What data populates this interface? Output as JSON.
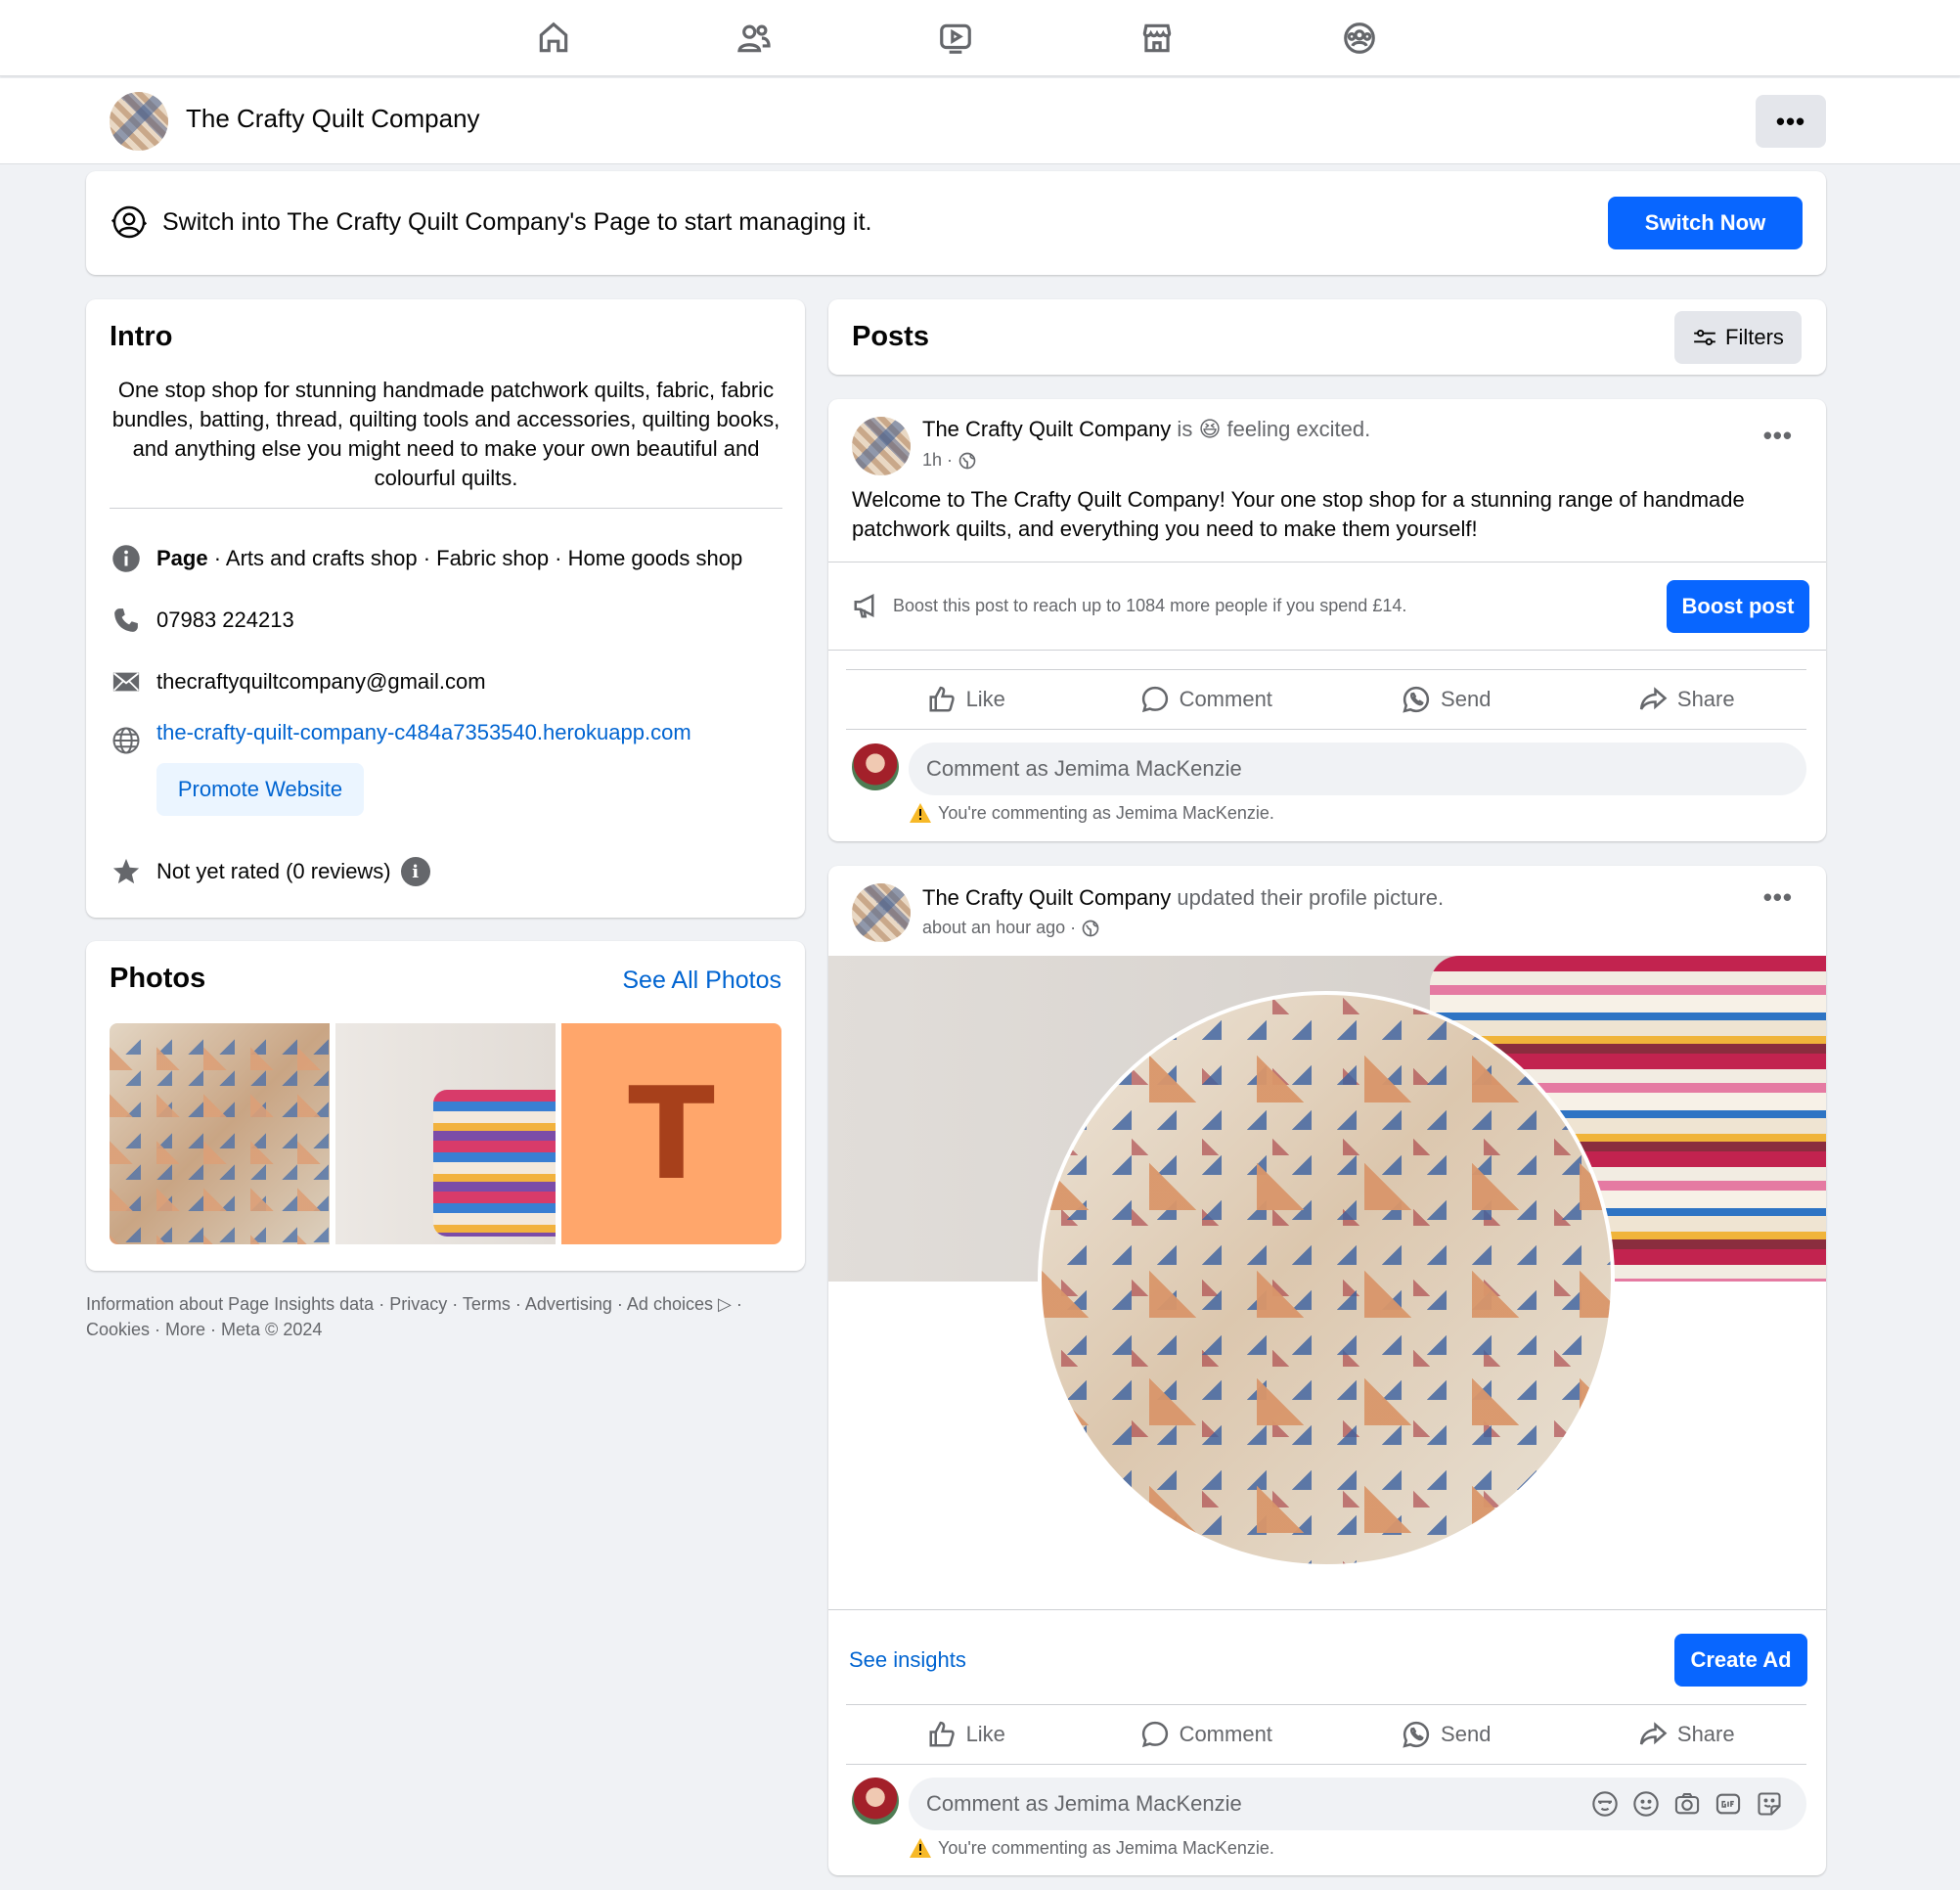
{
  "nav": {
    "items": [
      "home",
      "friends",
      "watch",
      "marketplace",
      "groups"
    ]
  },
  "page_header": {
    "title": "The Crafty Quilt Company",
    "more_label": "•••"
  },
  "switch_banner": {
    "text": "Switch into The Crafty Quilt Company's Page to start managing it.",
    "button": "Switch Now"
  },
  "intro": {
    "title": "Intro",
    "bio": "One stop shop for stunning handmade patchwork quilts, fabric, fabric bundles, batting, thread, quilting tools and accessories, quilting books, and anything else you might need to make your own beautiful and colourful quilts.",
    "category_strong": "Page",
    "category_rest": " · Arts and crafts shop · Fabric shop · Home goods shop",
    "phone": "07983 224213",
    "email": "thecraftyquiltcompany@gmail.com",
    "website": "the-crafty-quilt-company-c484a7353540.herokuapp.com",
    "promote_button": "Promote Website",
    "rating": "Not yet rated (0 reviews)",
    "info_glyph": "i"
  },
  "photos": {
    "title": "Photos",
    "see_all": "See All Photos",
    "thumb3_letter": "T"
  },
  "footer": {
    "line1": "Information about Page Insights data · Privacy · Terms · Advertising · Ad choices ▷ ·",
    "line2": "Cookies · More · Meta © 2024"
  },
  "posts": {
    "title": "Posts",
    "filters_label": "Filters",
    "items": [
      {
        "author": "The Crafty Quilt Company",
        "activity_pre": " is ",
        "emoji": "😆",
        "activity": " feeling excited.",
        "time": "1h ·",
        "body": "Welcome to The Crafty Quilt Company! Your one stop shop for a stunning range of handmade patchwork quilts, and everything you need to make them yourself!",
        "boost_text": "Boost this post to reach up to 1084 more people if you spend £14.",
        "boost_button": "Boost post"
      },
      {
        "author": "The Crafty Quilt Company",
        "activity": " updated their profile picture.",
        "time": "about an hour ago ·",
        "insights": "See insights",
        "ad_button": "Create Ad"
      }
    ],
    "actions": {
      "like": "Like",
      "comment": "Comment",
      "send": "Send",
      "share": "Share"
    },
    "comment_placeholder": "Comment as Jemima MacKenzie",
    "commenting_as": "You're commenting as Jemima MacKenzie."
  },
  "colors": {
    "primary": "#0866FF",
    "link": "#0064D1",
    "background": "#F0F2F5",
    "secondary_text": "#65676B"
  }
}
